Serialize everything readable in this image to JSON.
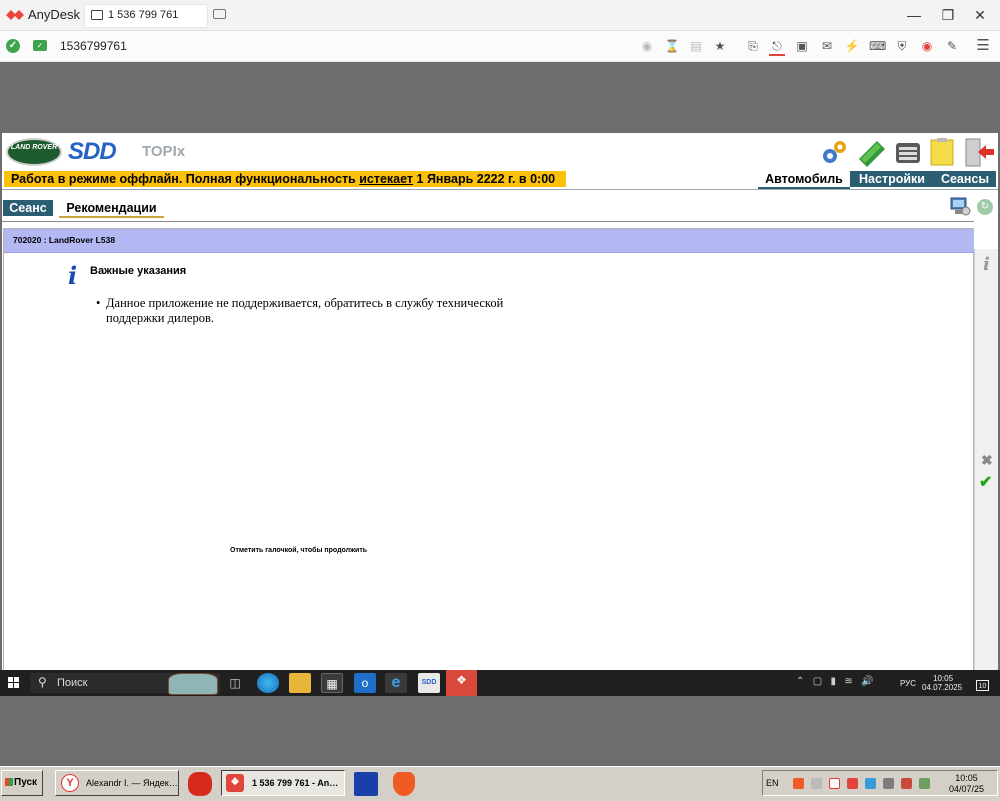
{
  "anydesk": {
    "app_name": "AnyDesk",
    "tab_label": "1 536 799 761",
    "address": "1536799761",
    "window_controls": [
      "minimize",
      "restore",
      "close"
    ],
    "toolbar_icons": [
      "privacy-icon",
      "hourglass-icon",
      "database-icon",
      "star-icon",
      "file-transfer-icon",
      "remote-input-icon",
      "display-icon",
      "chat-icon",
      "actions-icon",
      "keyboard-icon",
      "shield-icon",
      "record-icon",
      "draw-icon",
      "menu-icon"
    ]
  },
  "sdd": {
    "logo_text": "LAND ROVER",
    "brand": "SDD",
    "product": "TOPIx",
    "offline_prefix": "Работа в режиме оффлайн. Полная функциональность ",
    "offline_emph": "истекает",
    "offline_suffix": " 1 Январь 2222 г. в 0:00",
    "nav": {
      "vehicle": "Автомобиль",
      "settings": "Настройки",
      "sessions": "Сеансы"
    },
    "tabs": {
      "session": "Сеанс",
      "recommendations": "Рекомендации"
    },
    "vehicle_header": "702020 : LandRover L538",
    "notice_title": "Важные указания",
    "notice_body": "Данное приложение не поддерживается, обратитесь в службу технической поддержки дилеров.",
    "check_hint": "Отметить галочкой, чтобы продолжить",
    "accent_color": "#2b5d73",
    "banner_color": "#fbc00a",
    "header_color": "#b3b8f3"
  },
  "remote_taskbar": {
    "search_placeholder": "Поиск",
    "lang": "РУС",
    "time": "10:05",
    "date": "04.07.2025",
    "notifications": "10"
  },
  "local_taskbar": {
    "start_label": "Пуск",
    "task_browser": "Alexandr I. — Яндек…",
    "task_anydesk": "1 536 799 761 - An…",
    "lang": "EN",
    "time": "10:05",
    "date": "04/07/25"
  }
}
